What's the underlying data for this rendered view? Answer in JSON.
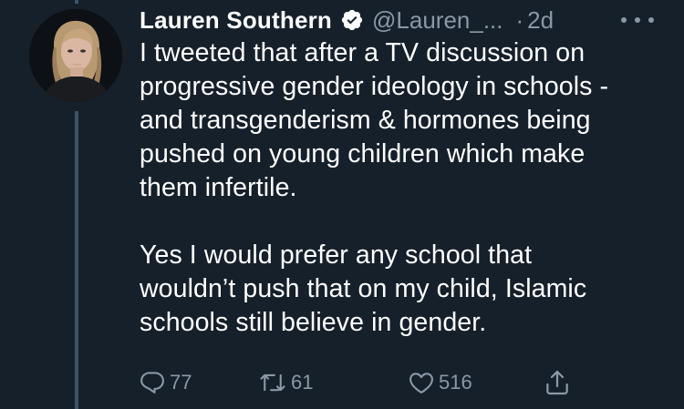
{
  "author": {
    "display_name": "Lauren Southern",
    "handle": "@Lauren_...",
    "verified": true
  },
  "time": {
    "separator": "·",
    "relative": "2d"
  },
  "tweet": {
    "paragraphs": [
      "I tweeted that after a TV discussion on\nprogressive gender ideology in schools -\nand transgenderism & hormones being\npushed on young children which make\nthem infertile.",
      "Yes I would prefer any school that\nwouldn’t push that on my child, Islamic\nschools still believe in gender."
    ]
  },
  "actions": {
    "reply_count": "77",
    "retweet_count": "61",
    "like_count": "516"
  },
  "icons": {
    "verified": "verified-badge-icon",
    "more": "more-dots-icon",
    "reply": "reply-icon",
    "retweet": "retweet-icon",
    "like": "heart-icon",
    "share": "share-icon"
  },
  "colors": {
    "background": "#15202b",
    "text_primary": "#ffffff",
    "text_secondary": "#8b98a5",
    "thread_line": "#3d5466"
  }
}
